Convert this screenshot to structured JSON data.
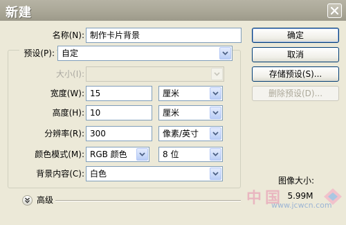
{
  "dialog": {
    "title": "新建"
  },
  "form": {
    "name": {
      "label": "名称(N):",
      "value": "制作卡片背景"
    },
    "preset": {
      "label": "预设(P):",
      "value": "自定"
    },
    "size": {
      "label": "大小(I):",
      "value": ""
    },
    "width": {
      "label": "宽度(W):",
      "value": "15",
      "unit": "厘米"
    },
    "height": {
      "label": "高度(H):",
      "value": "10",
      "unit": "厘米"
    },
    "resolution": {
      "label": "分辨率(R):",
      "value": "300",
      "unit": "像素/英寸"
    },
    "color_mode": {
      "label": "颜色模式(M):",
      "value": "RGB 颜色",
      "bit_depth": "8 位"
    },
    "background": {
      "label": "背景内容(C):",
      "value": "白色"
    },
    "advanced_label": "高级"
  },
  "buttons": {
    "ok": "确定",
    "cancel": "取消",
    "save_preset": "存储预设(S)...",
    "delete_preset": "删除预设(D)..."
  },
  "image_size": {
    "label": "图像大小:",
    "value": "5.99M"
  },
  "watermark": {
    "top": "中国",
    "url": "www.jcwcn.com"
  },
  "colors": {
    "accent": "#7f9db9",
    "dialog_bg": "#ece9d8",
    "title_bar": "#a9a696"
  }
}
